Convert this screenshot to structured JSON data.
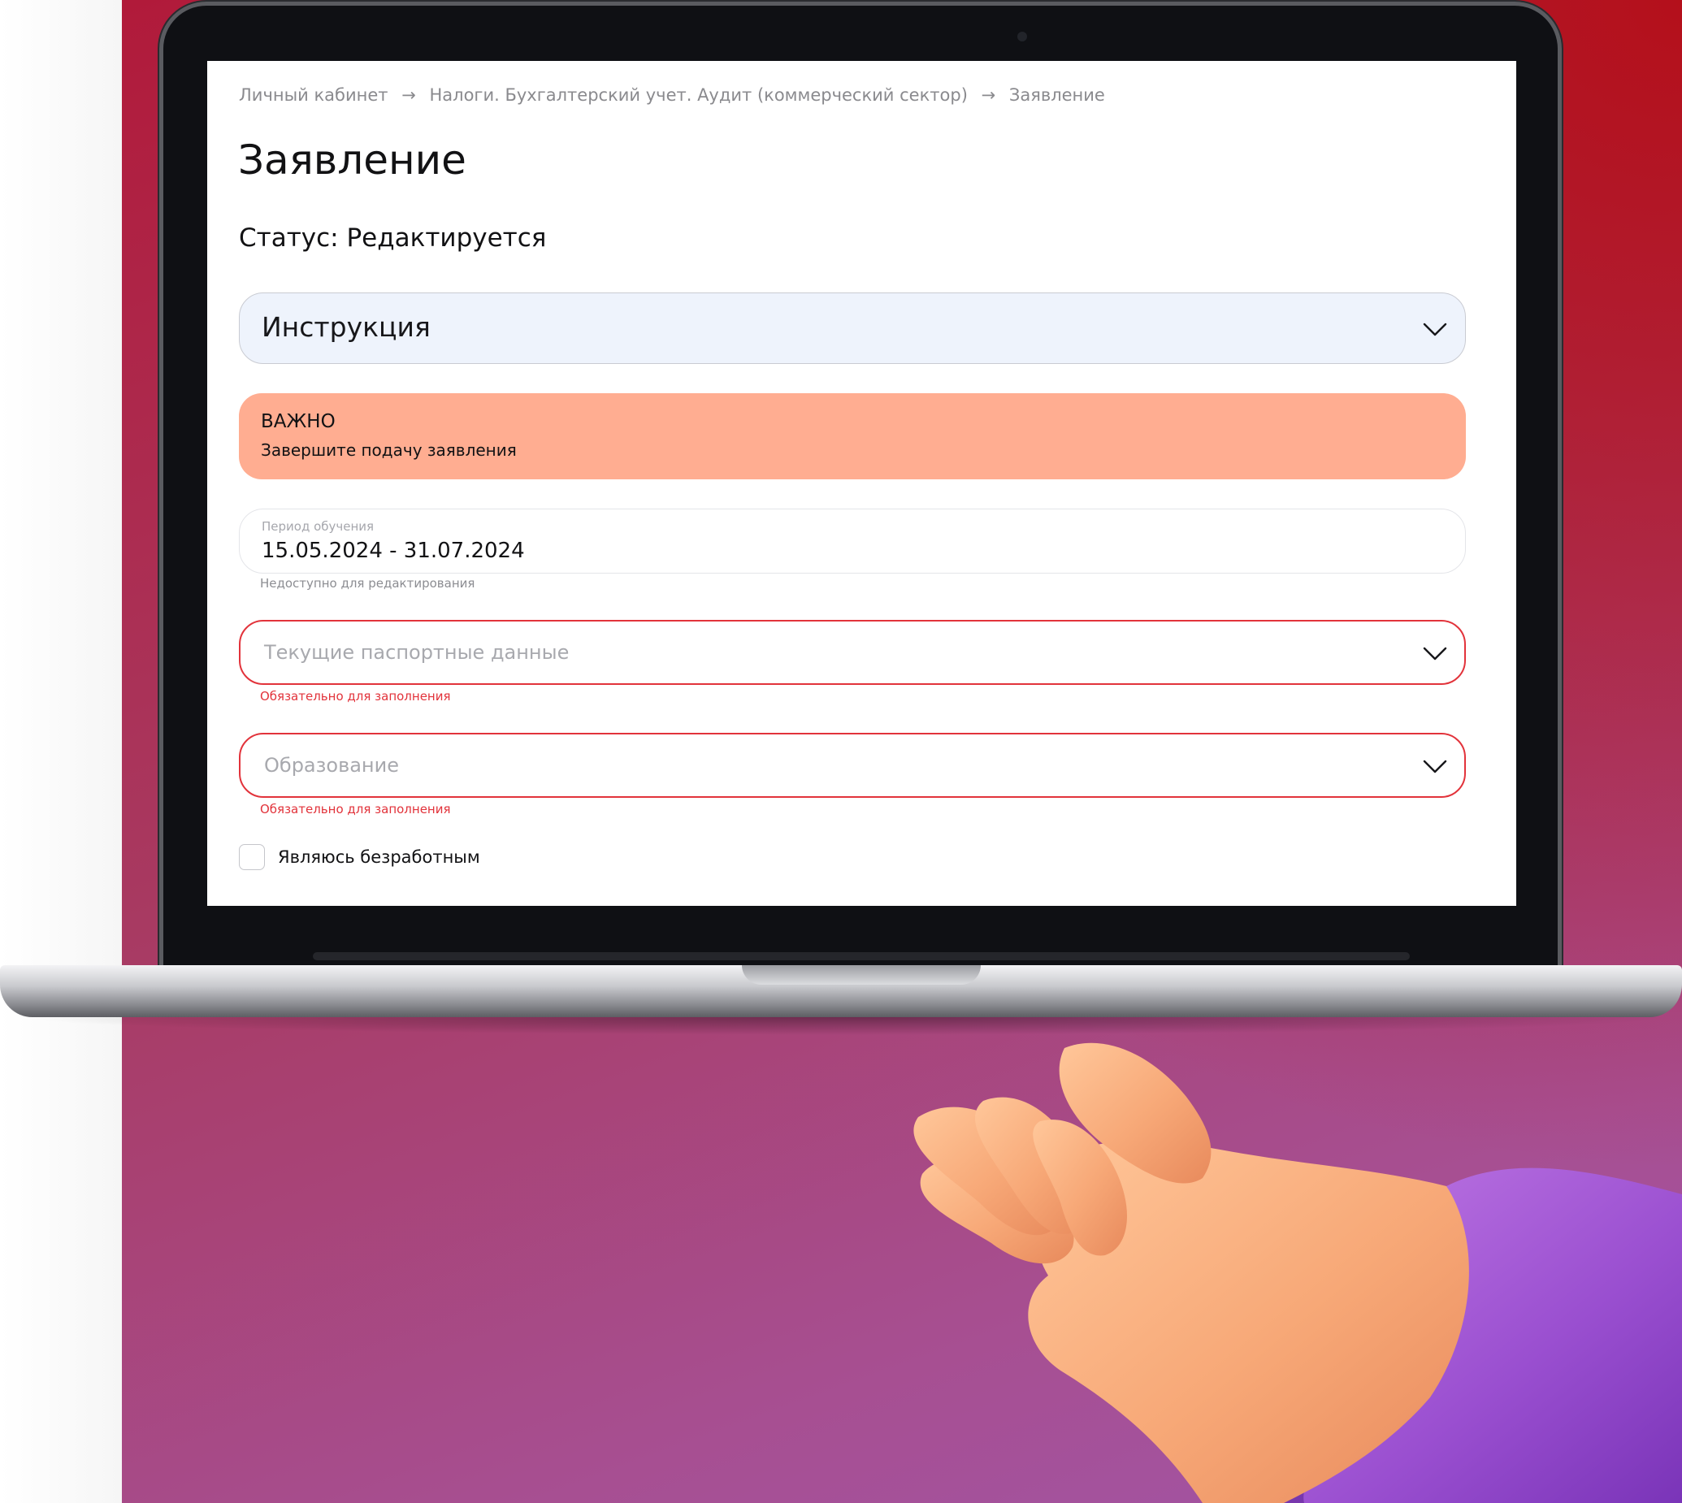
{
  "breadcrumb": {
    "items": [
      "Личный кабинет",
      "Налоги. Бухгалтерский учет. Аудит (коммерческий сектор)",
      "Заявление"
    ],
    "separator": "→"
  },
  "page": {
    "title": "Заявление",
    "status": "Статус: Редактируется"
  },
  "instruction": {
    "label": "Инструкция",
    "icon": "chevron-down-icon"
  },
  "alert": {
    "title": "ВАЖНО",
    "text": "Завершите подачу заявления",
    "color": "#ffad91"
  },
  "study_period": {
    "label": "Период обучения",
    "value": "15.05.2024 - 31.07.2024",
    "helper": "Недоступно для редактирования"
  },
  "passport": {
    "placeholder": "Текущие паспортные данные",
    "error": "Обязательно для заполнения"
  },
  "education": {
    "placeholder": "Образование",
    "error": "Обязательно для заполнения"
  },
  "unemployed": {
    "label": "Являюсь безработным",
    "checked": false
  },
  "colors": {
    "error": "#e2333b",
    "accordion_bg": "#eef3fc",
    "backdrop_top": "#b11a3a",
    "backdrop_bottom": "#a055a8"
  }
}
